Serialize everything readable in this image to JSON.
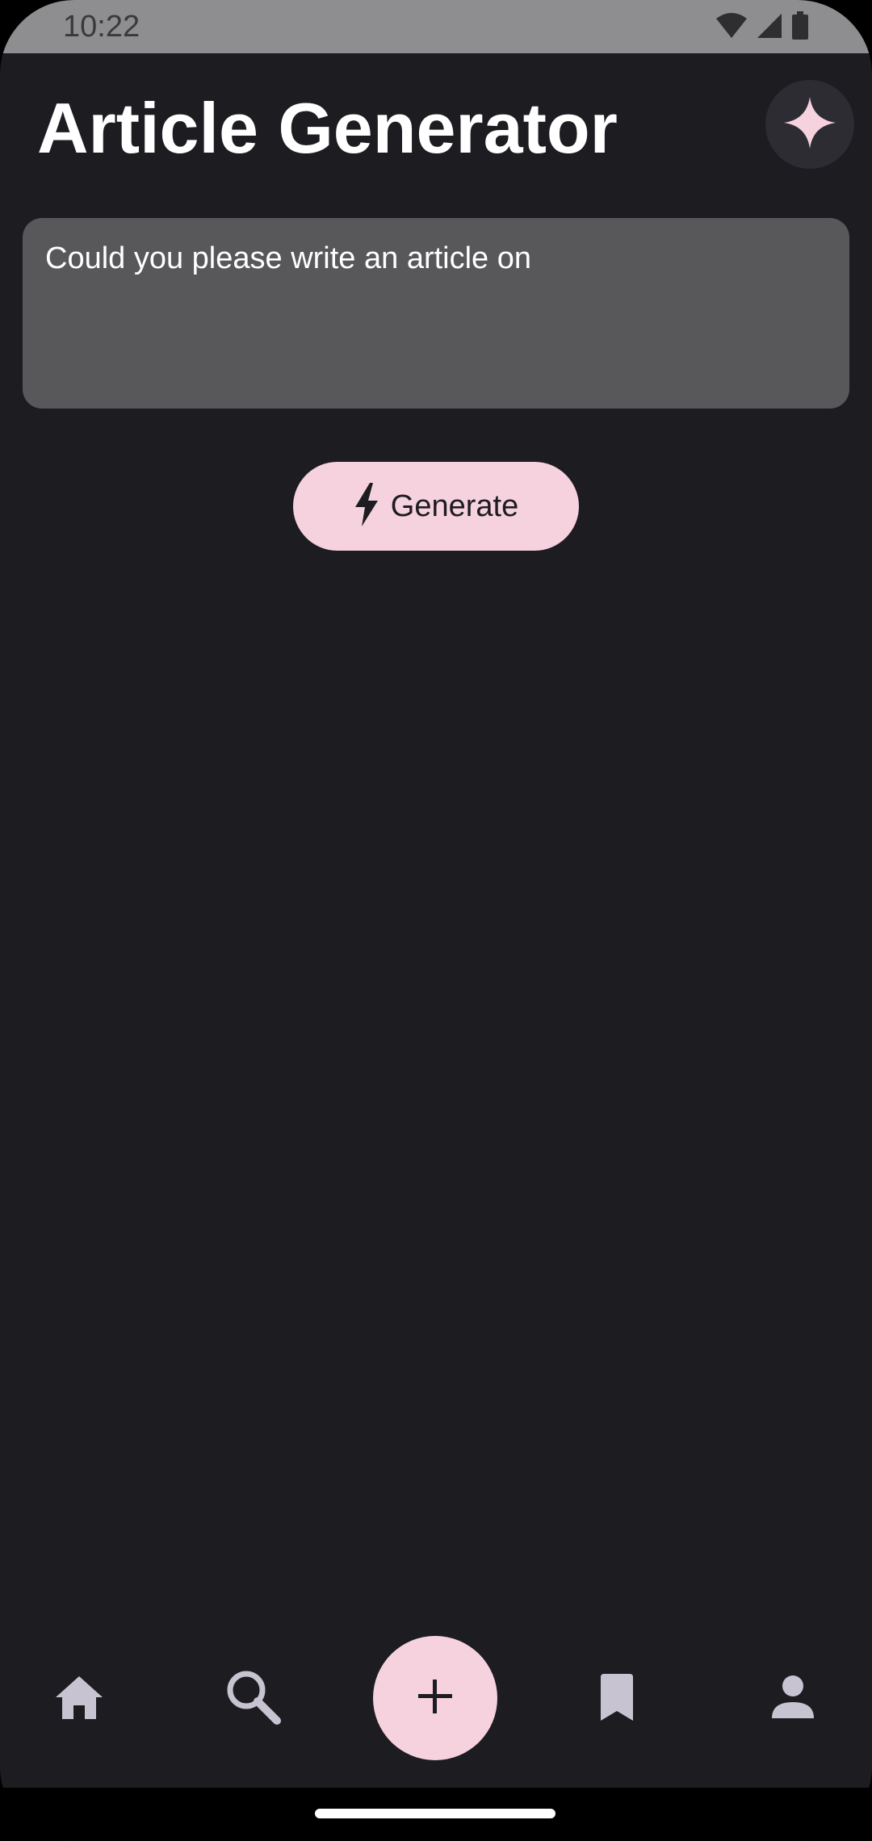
{
  "status_bar": {
    "time": "10:22",
    "icons": [
      "wifi-icon",
      "signal-icon",
      "battery-icon"
    ]
  },
  "header": {
    "title": "Article Generator",
    "action_icon": "sparkle-icon"
  },
  "prompt": {
    "value": "Could you please write an article on"
  },
  "generate": {
    "label": "Generate",
    "icon": "bolt-icon"
  },
  "bottom_nav": {
    "items": [
      {
        "icon": "home-icon"
      },
      {
        "icon": "search-icon"
      },
      {
        "icon": "add-icon"
      },
      {
        "icon": "bookmark-icon"
      },
      {
        "icon": "person-icon"
      }
    ]
  },
  "colors": {
    "background": "#1D1C21",
    "accent": "#F6D2DF",
    "input_background": "#58585B",
    "nav_icon": "#C7C3D0",
    "status_bar": "#8E8E90"
  }
}
